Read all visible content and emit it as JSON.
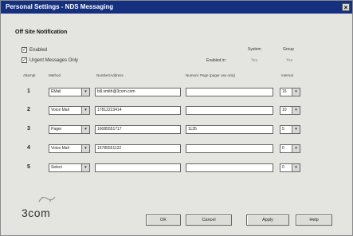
{
  "window": {
    "title": "Personal Settings - NDS Messaging",
    "close_glyph": "×"
  },
  "section": {
    "title": "Off Site Notification"
  },
  "options": [
    {
      "label": "Enabled",
      "checked": true
    },
    {
      "label": "Urgent Messages Only",
      "checked": true
    }
  ],
  "status": {
    "col_system": "System",
    "col_group": "Group",
    "row_label": "Enabled in:",
    "system_value": "Yes",
    "group_value": "Yes"
  },
  "table_headers": {
    "attempt": "Attempt",
    "method": "Method",
    "number": "Number/Address",
    "numeric_page": "Numeric Page (pager use only)",
    "interval": "Interval"
  },
  "rows": [
    {
      "num": "1",
      "method": "EMail",
      "address": "bill.smith@3com.com",
      "numeric": "",
      "interval": "15"
    },
    {
      "num": "2",
      "method": "Voice Mail",
      "address": "17812223414",
      "numeric": "",
      "interval": "10"
    },
    {
      "num": "3",
      "method": "Pager",
      "address": "16085551717",
      "numeric": "1135",
      "interval": "5"
    },
    {
      "num": "4",
      "method": "Voice Mail",
      "address": "16785551122",
      "numeric": "",
      "interval": "0"
    },
    {
      "num": "5",
      "method": "Select",
      "address": "",
      "numeric": "",
      "interval": "0"
    }
  ],
  "buttons": {
    "ok": "OK",
    "cancel": "Cancel",
    "apply": "Apply",
    "help": "Help"
  },
  "logo": {
    "text": "3com"
  }
}
